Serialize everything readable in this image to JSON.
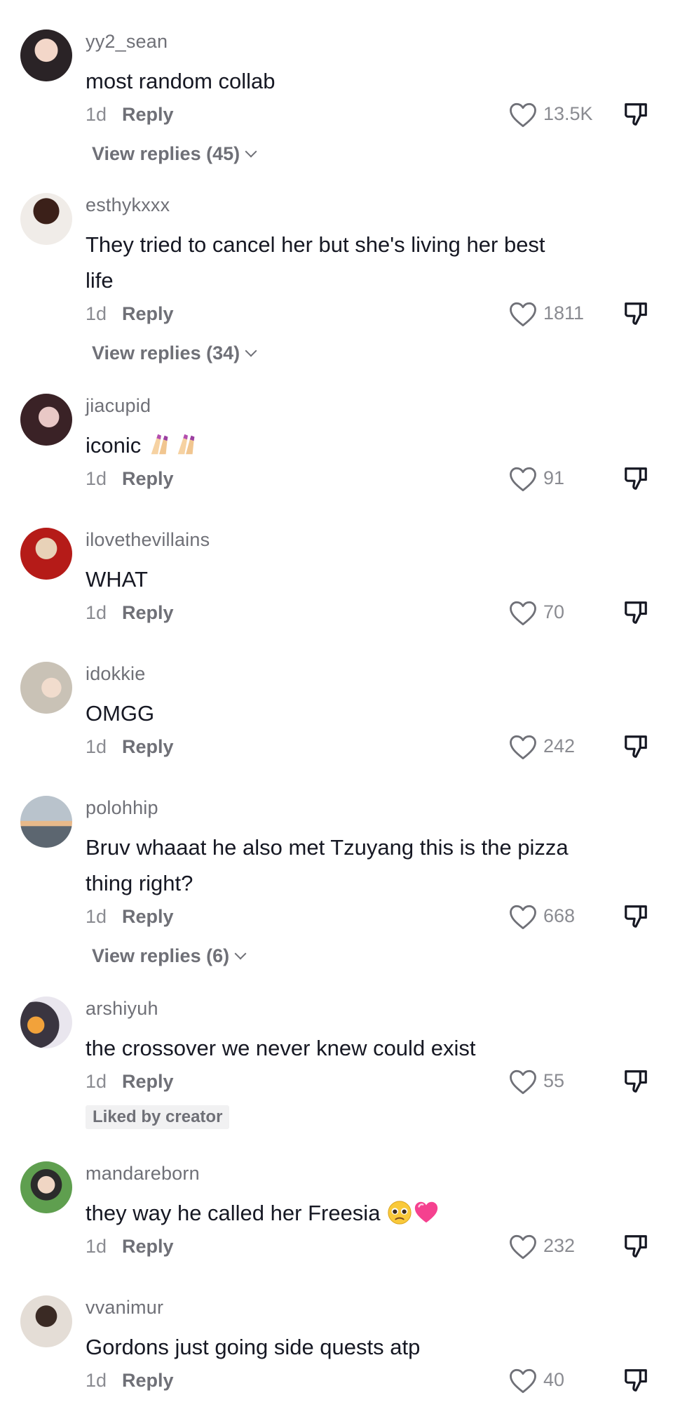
{
  "reply_label": "Reply",
  "comments": [
    {
      "username": "yy2_sean",
      "text": "most random collab",
      "time": "1d",
      "likes": "13.5K",
      "view_replies": "View replies (45)"
    },
    {
      "username": "esthykxxx",
      "text": "They tried to cancel her but she's living her best life",
      "time": "1d",
      "likes": "1811",
      "view_replies": "View replies (34)"
    },
    {
      "username": "jiacupid",
      "text": "iconic",
      "time": "1d",
      "likes": "91"
    },
    {
      "username": "ilovethevillains",
      "text": "WHAT",
      "time": "1d",
      "likes": "70"
    },
    {
      "username": "idokkie",
      "text": "OMGG",
      "time": "1d",
      "likes": "242"
    },
    {
      "username": "polohhip",
      "text": "Bruv whaaat he also met Tzuyang this is the pizza thing right?",
      "time": "1d",
      "likes": "668",
      "view_replies": "View replies (6)"
    },
    {
      "username": "arshiyuh",
      "text": "the crossover we never knew could exist",
      "time": "1d",
      "likes": "55",
      "badge": "Liked by creator"
    },
    {
      "username": "mandareborn",
      "text": "they way he called her Freesia",
      "time": "1d",
      "likes": "232"
    },
    {
      "username": "vvanimur",
      "text": "Gordons just going side quests atp",
      "time": "1d",
      "likes": "40"
    }
  ],
  "icons": {
    "like": "heart-outline-icon",
    "dislike": "thumbs-down-icon",
    "hands": "nail-polish-emoji",
    "face": "pleading-face-emoji",
    "heart": "pink-heart-emoji"
  }
}
